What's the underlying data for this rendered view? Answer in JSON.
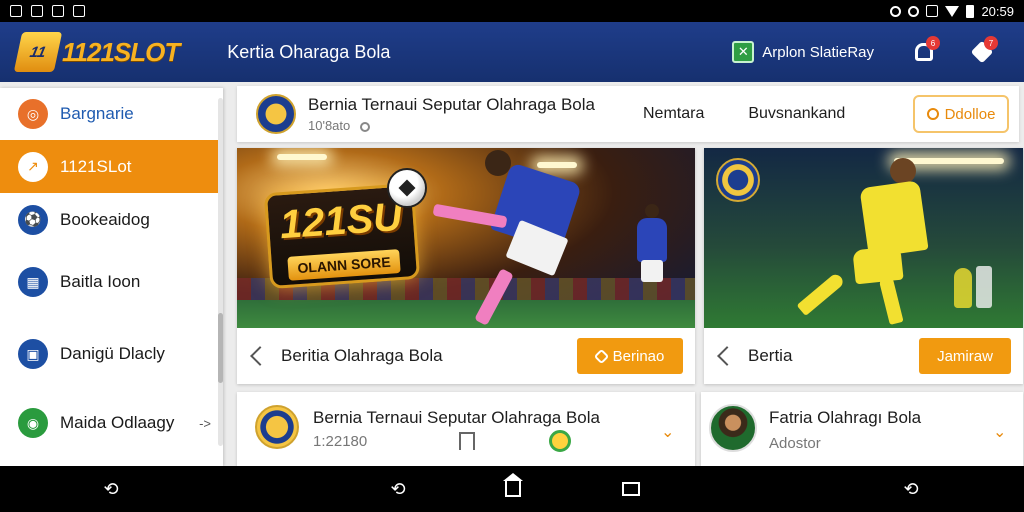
{
  "status_bar": {
    "time": "20:59",
    "battery_icon": "battery-icon",
    "wifi_icon": "wifi-icon"
  },
  "app_bar": {
    "logo_text": "1121SLOT",
    "logo_mark": "11",
    "title": "Kertia Oharaga Bola",
    "status_label": "Arplon SlatieRay",
    "status_icon": "check-box-icon",
    "notifications_badge": "6",
    "pin_badge": "7"
  },
  "sidebar": {
    "items": [
      {
        "label": "Bargnarie",
        "icon": "target-icon",
        "color": "#e8702a"
      },
      {
        "label": "1121SLot",
        "icon": "trend-icon",
        "active": true
      },
      {
        "label": "Bookeaidog",
        "icon": "football-icon",
        "color": "#1d4fa3"
      },
      {
        "label": "Baitla Ioon",
        "icon": "grid-icon",
        "color": "#1d4fa3"
      },
      {
        "label": "Danigü Dlacly",
        "icon": "calendar-icon",
        "color": "#1d4fa3"
      },
      {
        "label": "Maida Odlaagy",
        "icon": "shield-icon",
        "color": "#2a9b3e",
        "arrow": "->"
      }
    ]
  },
  "header": {
    "title": "Bernia Ternaui Seputar Olahraga Bola",
    "subtitle": "10'8ato",
    "link1": "Nemtara",
    "link2": "Buvsnankand",
    "button": "Ddolloe"
  },
  "cards": [
    {
      "promo_big": "121SU",
      "promo_plate": "OLANN SORE",
      "title": "Beritia  Olahraga Bola",
      "button": "Berinao"
    },
    {
      "title": "Bertia",
      "button": "Jamiraw"
    }
  ],
  "list": [
    {
      "title": "Bernia Ternaui Seputar Olahraga Bola",
      "meta": "1:22180"
    },
    {
      "title": "Fatria Olahragı Bola",
      "meta": "Adostor"
    }
  ],
  "colors": {
    "accent": "#f19a10",
    "brand_blue": "#1f3d8a",
    "logo_gold": "#f7b221"
  }
}
